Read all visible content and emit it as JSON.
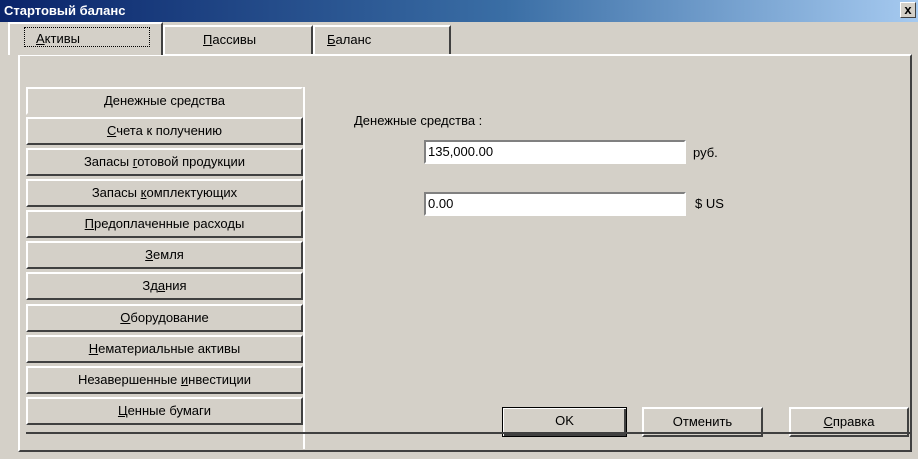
{
  "window": {
    "title": "Стартовый баланс",
    "close_label": "x"
  },
  "tabs": [
    {
      "pre": "",
      "u": "А",
      "post": "ктивы"
    },
    {
      "pre": "",
      "u": "П",
      "post": "ассивы"
    },
    {
      "pre": "",
      "u": "Б",
      "post": "аланс"
    }
  ],
  "sidebar": {
    "items": [
      {
        "pre": "",
        "u": "Д",
        "post": "енежные средства"
      },
      {
        "pre": "",
        "u": "С",
        "post": "чета к получению"
      },
      {
        "pre": "Запасы ",
        "u": "г",
        "post": "отовой продукции"
      },
      {
        "pre": "Запасы ",
        "u": "к",
        "post": "омплектующих"
      },
      {
        "pre": "",
        "u": "П",
        "post": "редоплаченные расходы"
      },
      {
        "pre": "",
        "u": "З",
        "post": "емля"
      },
      {
        "pre": "Зд",
        "u": "а",
        "post": "ния"
      },
      {
        "pre": "",
        "u": "О",
        "post": "борудование"
      },
      {
        "pre": "",
        "u": "Н",
        "post": "ематериальные активы"
      },
      {
        "pre": "Незавершенные ",
        "u": "и",
        "post": "нвестиции"
      },
      {
        "pre": "",
        "u": "Ц",
        "post": "енные бумаги"
      }
    ]
  },
  "main": {
    "field_label": "Денежные средства :",
    "rub_value": "135,000.00",
    "rub_unit": "руб.",
    "usd_value": "0.00",
    "usd_unit": "$ US"
  },
  "buttons": {
    "ok": "OK",
    "cancel": "Отменить",
    "help": {
      "pre": "",
      "u": "С",
      "post": "правка"
    }
  }
}
